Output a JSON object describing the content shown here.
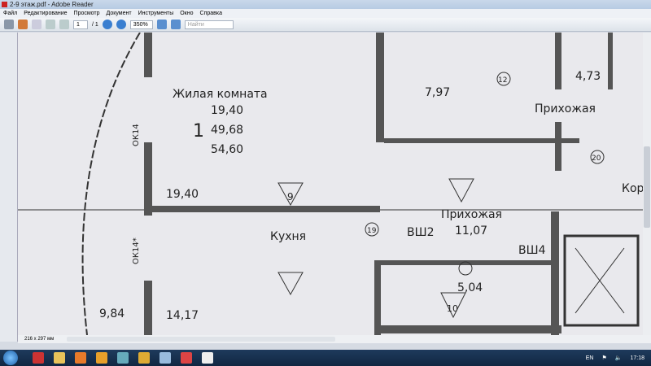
{
  "window": {
    "title": "2-9 этаж.pdf - Adobe Reader"
  },
  "menu": [
    "Файл",
    "Редактирование",
    "Просмотр",
    "Документ",
    "Инструменты",
    "Окно",
    "Справка"
  ],
  "toolbar": {
    "page_current": "1",
    "page_total": "/ 1",
    "zoom": "350%",
    "search_placeholder": "Найти"
  },
  "status": {
    "page_size": "216 x 297 мм"
  },
  "tray": {
    "lang": "EN",
    "time": "17:18"
  },
  "plan": {
    "living_room": "Жилая комната",
    "apt_number": "1",
    "living_area": "19,40",
    "total_area": "49,68",
    "full_area": "54,60",
    "living_area_bottom": "19,40",
    "window_1": "ОК14",
    "window_2": "ОК14*",
    "kitchen": "Кухня",
    "balcony_area": "9,84",
    "kitchen_area": "14,17",
    "room_797": "7,97",
    "room_473": "4,73",
    "hall_1": "Прихожая",
    "corridor": "Кор",
    "hall_2": "Прихожая",
    "hall_area": "11,07",
    "shaft_1": "ВШ2",
    "shaft_2": "ВШ4",
    "bath_area": "5,04",
    "tri_9": "9",
    "tri_10": "10",
    "circle_12": "12",
    "circle_19": "19",
    "circle_20": "20"
  }
}
